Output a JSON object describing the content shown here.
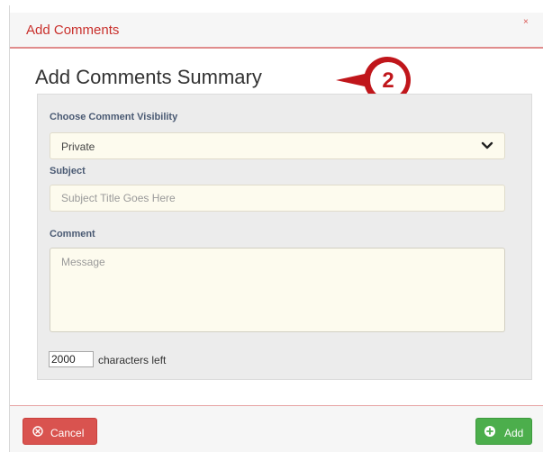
{
  "dialog": {
    "header_title": "Add Comments",
    "close_glyph": "×",
    "summary_title": "Add Comments Summary",
    "step_number": "2"
  },
  "form": {
    "visibility_label": "Choose Comment Visibility",
    "visibility_value": "Private",
    "subject_label": "Subject",
    "subject_placeholder": "Subject Title Goes Here",
    "subject_value": "",
    "comment_label": "Comment",
    "comment_placeholder": "Message",
    "comment_value": "",
    "characters_left_value": "2000",
    "characters_left_label": "characters left"
  },
  "footer": {
    "cancel_label": "Cancel",
    "add_label": "Add"
  },
  "icons": {
    "close": "close-icon",
    "chevron": "chevron-down-icon",
    "cancel": "cancel-circle-icon",
    "add": "plus-circle-icon",
    "step": "step-badge-icon"
  },
  "colors": {
    "header_text": "#c9302c",
    "header_rule": "#e08c8c",
    "label_text": "#4a5a73",
    "field_background": "#fdfbee",
    "panel_background": "#ececec",
    "cancel_button": "#d9534f",
    "add_button": "#4cae4c",
    "step_badge": "#c0161b"
  }
}
